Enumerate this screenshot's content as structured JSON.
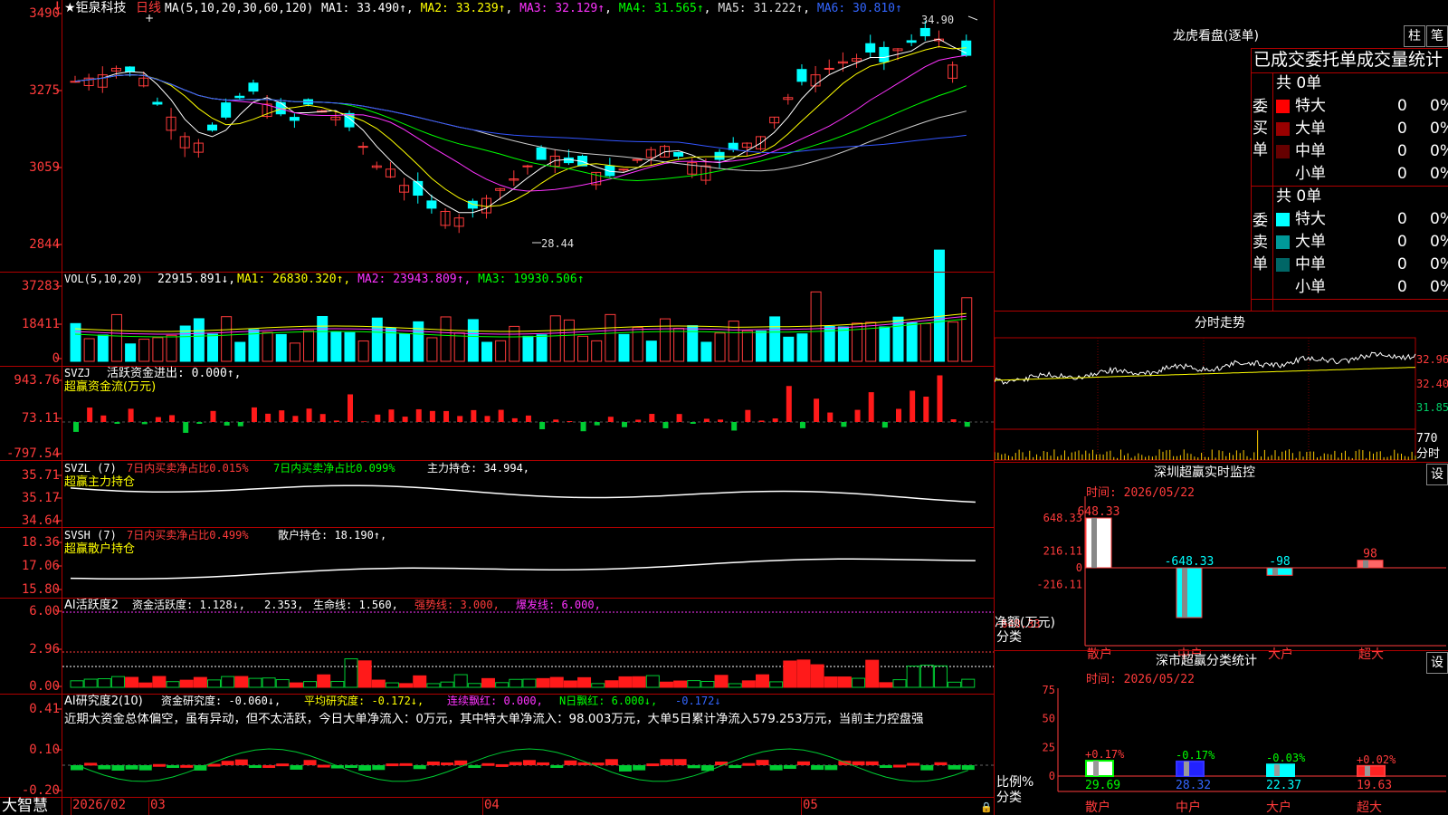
{
  "main": {
    "top_marker": "↓",
    "stock_name": "★钜泉科技",
    "period": "日线",
    "ma_label": "MA(5,10,20,30,60,120)",
    "ma": [
      {
        "label": "MA1: 33.490↑",
        "color": "#ffffff"
      },
      {
        "label": "MA2: 33.239↑",
        "color": "#ffff00"
      },
      {
        "label": "MA3: 32.129↑",
        "color": "#ff00ff"
      },
      {
        "label": "MA4: 31.565↑",
        "color": "#00ff00"
      },
      {
        "label": "MA5: 31.222↑",
        "color": "#cccccc"
      },
      {
        "label": "MA6: 30.810↑",
        "color": "#3355ff"
      }
    ],
    "y_ticks": [
      "3490",
      "3275",
      "3059",
      "2844"
    ],
    "high_label": "34.90",
    "low_label": "28.44"
  },
  "vol": {
    "label": "VOL(5,10,20)",
    "value": "22915.891↓,",
    "ma": [
      {
        "label": "MA1: 26830.320↑,",
        "color": "#ffff00"
      },
      {
        "label": "MA2: 23943.809↑,",
        "color": "#ff00ff"
      },
      {
        "label": "MA3: 19930.506↑",
        "color": "#00ff00"
      }
    ],
    "y_ticks": [
      "37283",
      "18411",
      "0"
    ]
  },
  "svzj": {
    "label": "SVZJ",
    "line1": "活跃资金进出: 0.000↑,",
    "line2": "超赢资金流(万元)",
    "y_ticks": [
      "943.76",
      "73.11",
      "-797.54"
    ]
  },
  "svzl": {
    "label": "SVZL (7)",
    "a": "7日内买卖净占比0.015%",
    "b": "7日内买卖净占比0.099%",
    "c": "主力持仓: 34.994,",
    "line2": "超赢主力持仓",
    "y_ticks": [
      "35.71",
      "35.17",
      "34.64"
    ]
  },
  "svsh": {
    "label": "SVSH (7)",
    "a": "7日内买卖净占比0.499%",
    "b": "散户持仓: 18.190↑,",
    "line2": "超赢散户持仓",
    "y_ticks": [
      "18.36",
      "17.06",
      "15.80"
    ]
  },
  "ai_active": {
    "label": "AI活跃度2",
    "a": "资金活跃度: 1.128↓,",
    "b": "2.353,",
    "c": "生命线: 1.560,",
    "d": "强势线: 3.000,",
    "e": "爆发线: 6.000,",
    "y_ticks": [
      "6.00",
      "2.96",
      "0.00"
    ]
  },
  "ai_research": {
    "label": "AI研究度2(10)",
    "a": "资金研究度: -0.060↓,",
    "b": "平均研究度: -0.172↓,",
    "c": "连续飘红: 0.000,",
    "d": "N日飘红: 6.000↓,",
    "e": "-0.172↓",
    "comment": "近期大资金总体偏空，虽有异动，但不太活跃，今日大单净流入：0万元，其中特大单净流入：98.003万元，大单5日累计净流入579.253万元，当前主力控盘强",
    "y_ticks": [
      "0.41",
      "0.10",
      "-0.20"
    ]
  },
  "date_axis": {
    "labels": [
      "2026/02",
      "03",
      "04",
      "05"
    ]
  },
  "brand": "大智慧",
  "dragon": {
    "title": "龙虎看盘(逐单)",
    "btn_bar": "柱",
    "btn_pen": "笔",
    "tabs": "已成交委托单成交量统计",
    "buy_side": "委买单",
    "sell_side": "委卖单",
    "buy_total": "共 0单",
    "sell_total": "共 0单",
    "buy_rows": [
      {
        "name": "特大",
        "count": "0",
        "pct": "0%",
        "color": "#ff0000"
      },
      {
        "name": "大单",
        "count": "0",
        "pct": "0%",
        "color": "#990000"
      },
      {
        "name": "中单",
        "count": "0",
        "pct": "0%",
        "color": "#660000"
      },
      {
        "name": "小单",
        "count": "0",
        "pct": "0%",
        "color": ""
      }
    ],
    "sell_rows": [
      {
        "name": "特大",
        "count": "0",
        "pct": "0%",
        "color": "#00ffff"
      },
      {
        "name": "大单",
        "count": "0",
        "pct": "0%",
        "color": "#009999"
      },
      {
        "name": "中单",
        "count": "0",
        "pct": "0%",
        "color": "#006666"
      },
      {
        "name": "小单",
        "count": "0",
        "pct": "0%",
        "color": ""
      }
    ]
  },
  "intraday": {
    "title": "分时走势",
    "y_ticks": [
      "32.96",
      "32.40",
      "31.85"
    ],
    "vol_tick": "770",
    "vol_unit": "分时"
  },
  "monitor": {
    "title": "深圳超赢实时监控",
    "btn": "设",
    "time": "时间: 2026/05/22",
    "y_ticks": [
      "648.33",
      "216.11",
      "0",
      "-216.11",
      "-648.33"
    ],
    "net_label": "净额(万元)",
    "cat_label": "分类",
    "chart_data": {
      "type": "bar",
      "categories": [
        "散户",
        "中户",
        "大户",
        "超大"
      ],
      "values": [
        648.33,
        -648.33,
        -98,
        98
      ],
      "labels": [
        "648.33",
        "-648.33",
        "-98",
        "98"
      ],
      "ylim": [
        -648.33,
        648.33
      ]
    }
  },
  "classify": {
    "title": "深市超赢分类统计",
    "btn": "设",
    "time": "时间: 2026/05/22",
    "y_ticks": [
      "75",
      "50",
      "25",
      "0"
    ],
    "ratio_label": "比例%",
    "cat_label": "分类",
    "chart_data": {
      "type": "bar",
      "categories": [
        "散户",
        "中户",
        "大户",
        "超大"
      ],
      "values": [
        29.69,
        28.32,
        22.37,
        19.63
      ],
      "value_labels": [
        "29.69",
        "28.32",
        "22.37",
        "19.63"
      ],
      "change_labels": [
        "+0.17%",
        "-0.17%",
        "-0.03%",
        "+0.02%"
      ],
      "ylim": [
        0,
        75
      ]
    }
  }
}
